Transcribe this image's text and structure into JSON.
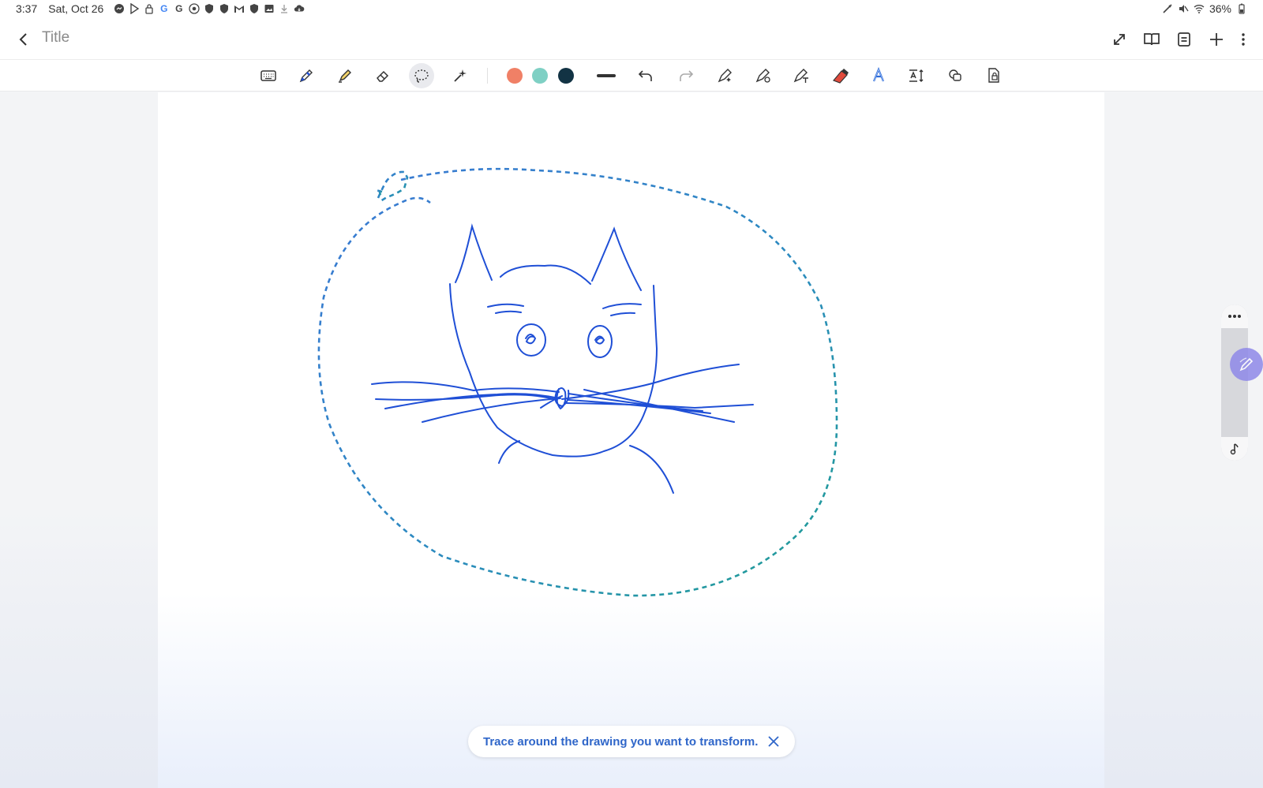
{
  "status_bar": {
    "time": "3:37",
    "date": "Sat, Oct 26",
    "battery": "36%",
    "notification_icons": [
      "messenger-icon",
      "play-store-icon",
      "lock-icon",
      "google-icon",
      "google-icon",
      "chrome-icon",
      "shield-icon",
      "shield-icon",
      "gmail-icon",
      "shield-icon",
      "gallery-icon",
      "download-icon",
      "cloud-icon"
    ],
    "right_icons": [
      "stylus-icon",
      "mute-icon",
      "wifi-icon",
      "battery-icon"
    ]
  },
  "app_bar": {
    "title": "Title",
    "actions": [
      "expand-icon",
      "book-view-icon",
      "page-list-icon",
      "add-icon",
      "more-vert-icon"
    ]
  },
  "toolbar": {
    "tools": [
      "keyboard",
      "pen",
      "highlighter",
      "eraser",
      "lasso",
      "ai-assist"
    ],
    "active_tool": "lasso",
    "colors": [
      "#f08066",
      "#7fd0c4",
      "#123344"
    ],
    "extra_tools": [
      "stroke-width",
      "undo",
      "redo",
      "lasso-sparkle",
      "pen-settings",
      "text-pen",
      "red-eraser",
      "text-style",
      "text-size",
      "shapes",
      "lock-page"
    ]
  },
  "toast": {
    "message": "Trace around the drawing you want to transform."
  },
  "colors": {
    "ink_blue": "#1f4fd6",
    "lasso_start": "#3a78d4",
    "lasso_end": "#1f9e93",
    "fab_purple": "#8f89e8"
  }
}
